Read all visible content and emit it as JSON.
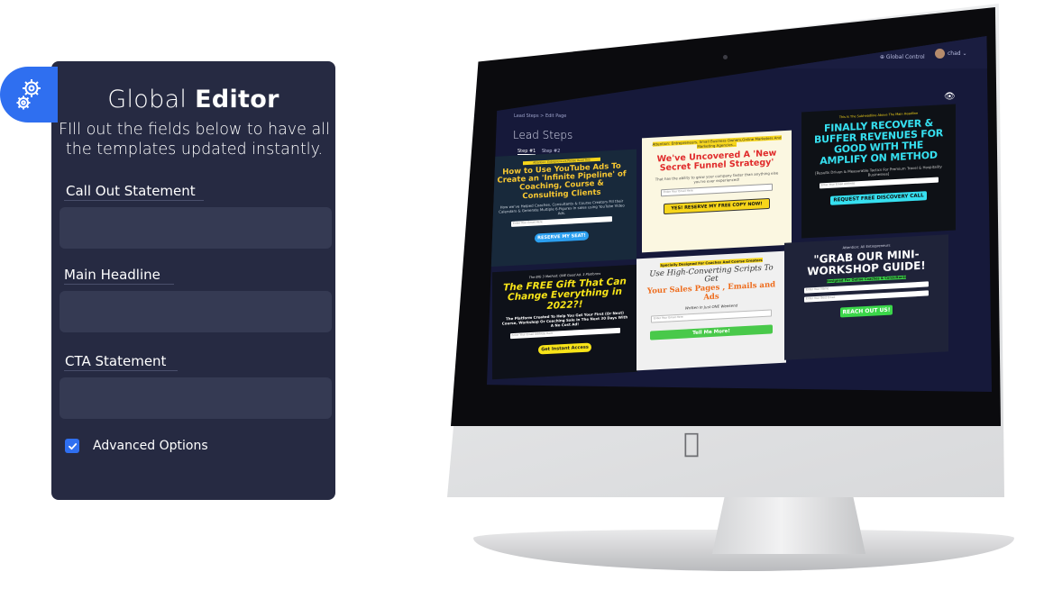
{
  "editor": {
    "title_light": "Global ",
    "title_bold": "Editor",
    "subtitle": "FIll out the fields below to have all the templates updated instantly.",
    "fields": [
      {
        "label": "Call Out Statement",
        "value": ""
      },
      {
        "label": "Main Headline",
        "value": ""
      },
      {
        "label": "CTA Statement",
        "value": ""
      }
    ],
    "advanced_label": "Advanced Options",
    "advanced_checked": true,
    "gear_icon": "gear-icon"
  },
  "screen": {
    "global_control": "⊕ Global Control",
    "user_name": "chad ⌄",
    "breadcrumb": "Lead Steps  >  Edit Page",
    "page_title": "Lead Steps",
    "tabs": [
      "Step #1",
      "Step #2"
    ],
    "cards": [
      {
        "strip": "Attention: Entrepreneurs Please Read This",
        "headline": "How to Use YouTube Ads To Create an 'Infinite Pipeline' of Coaching, Course & Consulting Clients",
        "body": "How we've Helped Coaches, Consultants & Course Creators Fill their Calendars & Generate Multiple 6-Figures In sales using YouTube Video Ads.",
        "input": "Enter Your Email Here",
        "button": "RESERVE MY SEAT!"
      },
      {
        "strip": "Attention: Entrepreneurs, Small Business Owners,Online Marketers And Marketing Agencies...",
        "headline": "We've Uncovered A 'New Secret Funnel Strategy'",
        "body": "That has the ability to grow your company faster than anything else you've ever experienced!",
        "input": "Enter Your Email Here",
        "button": "YES! RESERVE MY FREE COPY NOW!"
      },
      {
        "strip": "This Is The Subheadline Above The Main Headline",
        "headline": "FINALLY RECOVER & BUFFER REVENUES FOR GOOD WITH THE AMPLIFY ON METHOD",
        "body": "[Results Driven & Measurable Tactics For Premium Travel & Hospitality Businesses]",
        "input": "Enter Your Email Address",
        "button": "REQUEST FREE DISCOVERY CALL"
      },
      {
        "strip": "The BIG 3 Method: ONE Good Ad. 3 Platforms",
        "headline": "The FREE Gift That Can Change Everything in 2022?!",
        "body": "The Platform Created To Help You Get Your First (Or Next) Course, Workshop Or Coaching Sale In The Next 30 Days With A No Cost Ad!",
        "input": "Enter Your Email Address Here",
        "button": "Get Instant Access"
      },
      {
        "strip": "Specially Designed For Coaches And Course Creators",
        "headline": "Use High-Converting Scripts To Get",
        "headline_accent": "Your Sales Pages , Emails and Ads",
        "body": "Written In Just ONE Weekend",
        "input": "Enter Your Email Here",
        "button": "Tell Me More!"
      },
      {
        "strip": "Attention: All Entrepreneurs",
        "headline": "\"GRAB OUR MINI-WORKSHOP GUIDE!",
        "strip2": "Designed For Online Coaches & Consultants",
        "input": "Enter Your Name",
        "input2": "Enter Your Best Email",
        "button": "REACH OUT US!"
      }
    ]
  },
  "colors": {
    "accent": "#2f6ff0",
    "panel_bg": "#262a42",
    "screen_bg": "#16193a"
  }
}
